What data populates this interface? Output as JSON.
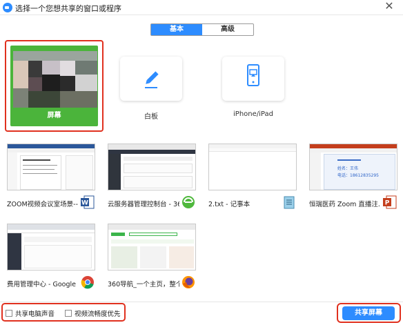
{
  "window": {
    "title": "选择一个您想共享的窗口或程序",
    "close": "✕"
  },
  "tabs": [
    {
      "label": "基本",
      "active": true
    },
    {
      "label": "高级",
      "active": false
    }
  ],
  "top_options": {
    "screen": {
      "label": "屏幕",
      "selected": true
    },
    "whiteboard": {
      "label": "白板",
      "icon": "pencil-icon"
    },
    "iphone": {
      "label": "iPhone/iPad",
      "icon": "airplay-device-icon"
    }
  },
  "windows": [
    {
      "label": "ZOOM视频会议室场景--...",
      "icon": "word-icon"
    },
    {
      "label": "云服务器管理控制台 - 360...",
      "icon": "360-browser-icon"
    },
    {
      "label": "2.txt - 记事本",
      "icon": "notepad-icon"
    },
    {
      "label": "恒瑞医药 Zoom 直播注...",
      "icon": "powerpoint-icon",
      "card_name": "姓名：王伟",
      "card_phone": "电话：18612835295"
    },
    {
      "label": "费用管理中心 - Google ...",
      "icon": "chrome-icon"
    },
    {
      "label": "360导航_一个主页，整个...",
      "icon": "firefox-icon"
    }
  ],
  "bottom": {
    "share_audio": {
      "label": "共享电脑声音",
      "checked": false
    },
    "optimize_video": {
      "label": "视频流畅度优先",
      "checked": false
    },
    "share_button": "共享屏幕"
  },
  "colors": {
    "accent": "#2d8cff",
    "screen_tile": "#4bb43b",
    "highlight": "#e0301e"
  }
}
